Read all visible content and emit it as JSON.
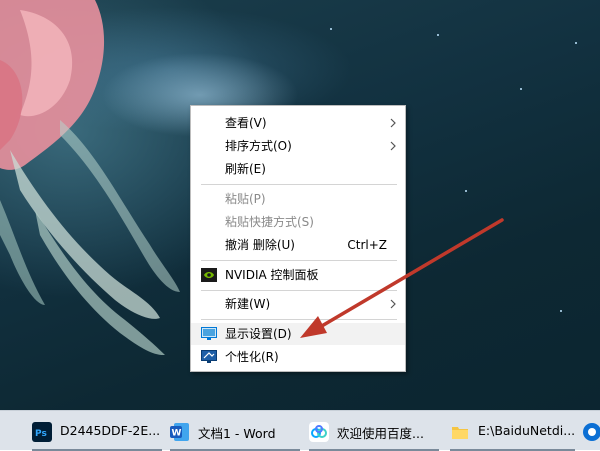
{
  "context_menu": {
    "items": [
      {
        "label": "查看(V)",
        "shortcut": "",
        "submenu": true,
        "disabled": false
      },
      {
        "label": "排序方式(O)",
        "shortcut": "",
        "submenu": true,
        "disabled": false
      },
      {
        "label": "刷新(E)",
        "shortcut": "",
        "submenu": false,
        "disabled": false
      },
      {
        "label": "粘贴(P)",
        "shortcut": "",
        "submenu": false,
        "disabled": true
      },
      {
        "label": "粘贴快捷方式(S)",
        "shortcut": "",
        "submenu": false,
        "disabled": true
      },
      {
        "label": "撤消 删除(U)",
        "shortcut": "Ctrl+Z",
        "submenu": false,
        "disabled": false
      },
      {
        "label": "NVIDIA 控制面板",
        "shortcut": "",
        "submenu": false,
        "disabled": false,
        "icon": "nvidia-icon"
      },
      {
        "label": "新建(W)",
        "shortcut": "",
        "submenu": true,
        "disabled": false
      },
      {
        "label": "显示设置(D)",
        "shortcut": "",
        "submenu": false,
        "disabled": false,
        "icon": "display-settings-icon",
        "highlighted": true
      },
      {
        "label": "个性化(R)",
        "shortcut": "",
        "submenu": false,
        "disabled": false,
        "icon": "personalize-icon"
      }
    ]
  },
  "taskbar": {
    "items": [
      {
        "label": "D2445DDF-2E...",
        "icon": "photoshop-icon"
      },
      {
        "label": "文档1 - Word",
        "icon": "word-icon"
      },
      {
        "label": "欢迎使用百度...",
        "icon": "baidu-netdisk-icon"
      },
      {
        "label": "E:\\BaiduNetdi...",
        "icon": "folder-icon"
      }
    ]
  },
  "colors": {
    "arrow": "#c0392b",
    "accent_blue": "#0078d7",
    "nvidia_green": "#76b900"
  }
}
